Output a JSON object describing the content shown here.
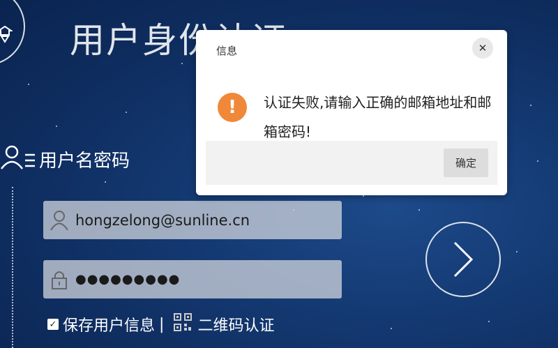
{
  "header": {
    "title": "用户身份认证"
  },
  "login": {
    "section_title": "用户名密码",
    "username_value": "hongzelong@sunline.cn",
    "password_value": "●●●●●●●●●"
  },
  "options": {
    "remember_label": "保存用户信息",
    "separator": "|",
    "qr_label": "二维码认证"
  },
  "dialog": {
    "title": "信息",
    "message": "认证失败,请输入正确的邮箱地址和邮箱密码!",
    "ok_label": "确定",
    "close_symbol": "✕",
    "icon_symbol": "!",
    "icon_color": "#f0883a"
  },
  "icons": [
    "logo-icon",
    "user-list-icon",
    "user-icon",
    "lock-icon",
    "qr-code-icon",
    "arrow-right-icon",
    "close-icon",
    "warning-icon",
    "check-icon"
  ]
}
